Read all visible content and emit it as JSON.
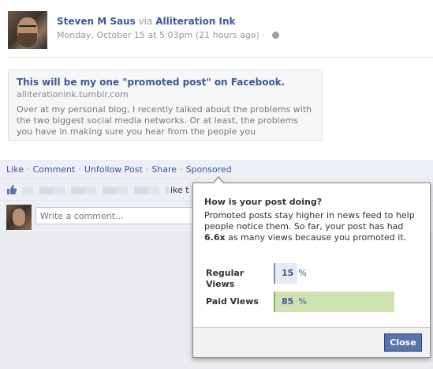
{
  "post": {
    "author": "Steven M Saus",
    "via_label": "via",
    "via_source": "Alliteration Ink",
    "timestamp": "Monday, October 15 at 5:03pm (21 hours ago)",
    "meta_separator": "·",
    "privacy_icon": "globe-icon"
  },
  "link_card": {
    "title": "This will be my one \"promoted post\" on Facebook.",
    "domain": "alliterationink.tumblr.com",
    "description": "Over at my personal blog, I recently talked about the problems with the two biggest social media networks. Or at least, the problems you have in making sure you hear from the people you"
  },
  "actions": {
    "like": "Like",
    "comment": "Comment",
    "unfollow": "Unfollow Post",
    "share": "Share",
    "sponsored": "Sponsored",
    "separator": "·"
  },
  "likes": {
    "text_visible": "ike t",
    "icon": "thumbs-up-icon"
  },
  "comment_box": {
    "placeholder": "Write a comment..."
  },
  "popover": {
    "title": "How is your post doing?",
    "body_prefix": "Promoted posts stay higher in news feed to help people notice them. So far, your post has had ",
    "multiplier": "6.6x",
    "body_suffix": " as many views because you promoted it.",
    "stats": [
      {
        "label": "Regular Views",
        "value": "15",
        "unit": "%",
        "percent": 15
      },
      {
        "label": "Paid Views",
        "value": "85",
        "unit": "%",
        "percent": 85
      }
    ],
    "close_label": "Close"
  },
  "colors": {
    "link_blue": "#3b5998",
    "action_bar_bg": "#eceff5",
    "regular_bar": "#e6eaf3",
    "paid_bar": "#cfe3b2",
    "button_blue": "#5b74a8"
  }
}
